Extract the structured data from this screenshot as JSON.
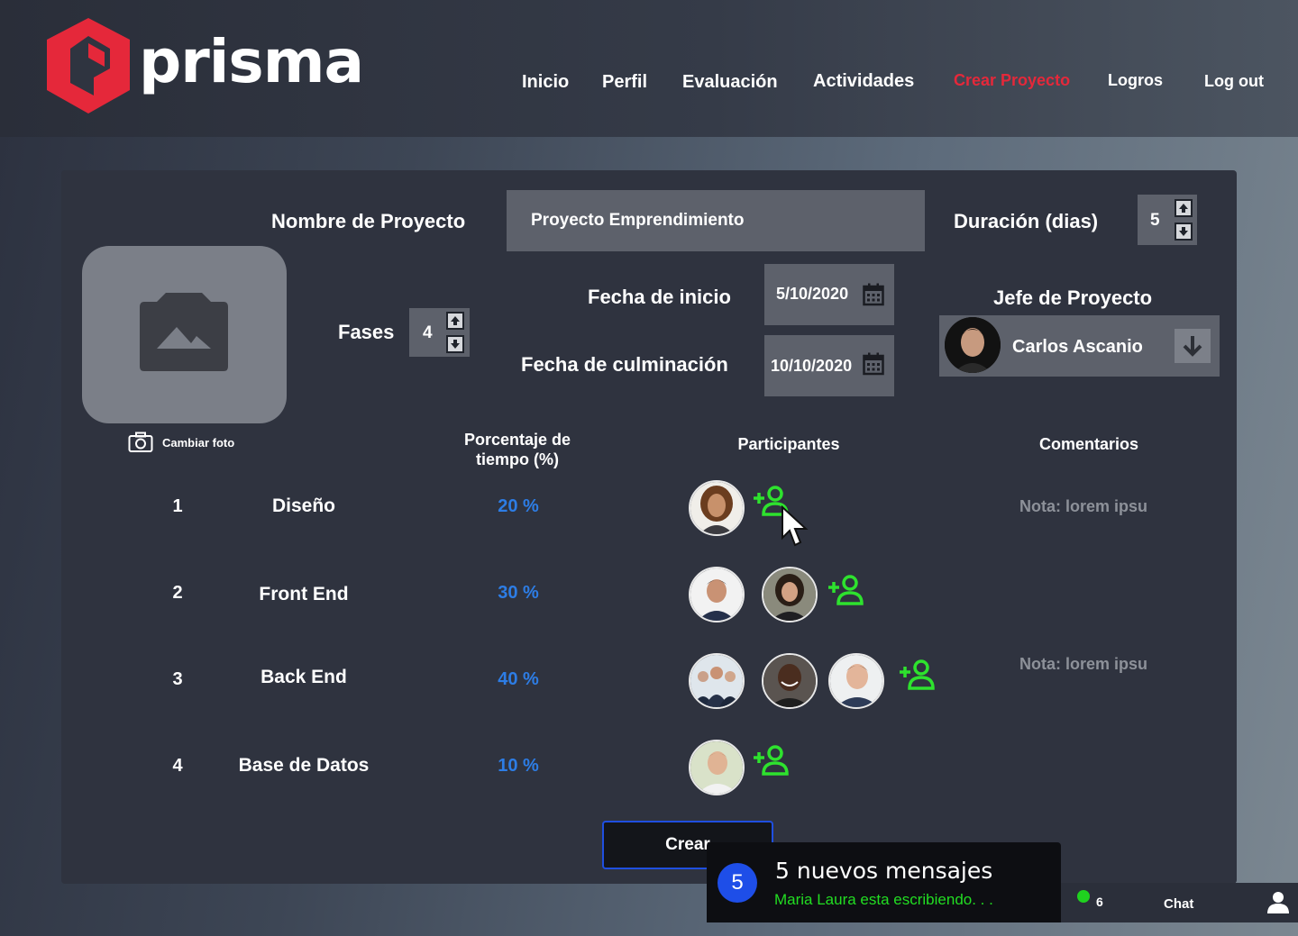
{
  "brand": {
    "name": "prisma",
    "accent": "#e5283a"
  },
  "nav": [
    "Inicio",
    "Perfil",
    "Evaluación",
    "Actividades",
    "Crear Proyecto",
    "Logros",
    "Log out"
  ],
  "form": {
    "project_name_label": "Nombre de Proyecto",
    "project_name_value": "Proyecto Emprendimiento",
    "duration_label": "Duración (dias)",
    "duration_value": "5",
    "phases_label": "Fases",
    "phases_value": "4",
    "start_label": "Fecha de inicio",
    "start_value": "5/10/2020",
    "end_label": "Fecha de culminación",
    "end_value": "10/10/2020",
    "manager_label": "Jefe de Proyecto",
    "manager_value": "Carlos Ascanio",
    "change_photo": "Cambiar foto"
  },
  "table": {
    "headers": {
      "percent": "Porcentaje de tiempo (%)",
      "participants": "Participantes",
      "comments": "Comentarios"
    },
    "rows": [
      {
        "num": "1",
        "phase": "Diseño",
        "percent": "20 %",
        "note": "Nota: lorem ipsu"
      },
      {
        "num": "2",
        "phase": "Front End",
        "percent": "30 %",
        "note": ""
      },
      {
        "num": "3",
        "phase": "Back End",
        "percent": "40 %",
        "note": "Nota: lorem ipsu"
      },
      {
        "num": "4",
        "phase": "Base de Datos",
        "percent": "10 %",
        "note": ""
      }
    ]
  },
  "create_button": "Crear",
  "toast": {
    "count": "5",
    "title": "5 nuevos mensajes",
    "subtitle": "Maria Laura esta escribiendo. . ."
  },
  "chatbar": {
    "online": "6",
    "chat": "Chat"
  }
}
